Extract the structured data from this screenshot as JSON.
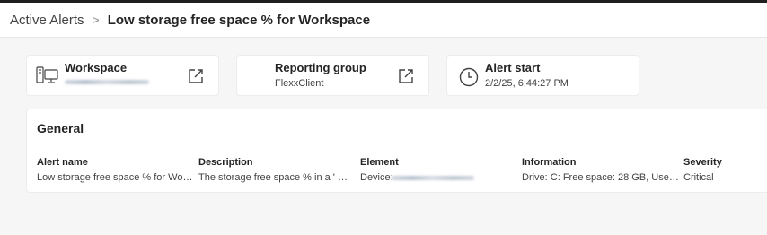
{
  "breadcrumb": {
    "parent": "Active Alerts",
    "separator": ">",
    "current": "Low storage free space % for Workspace"
  },
  "cards": {
    "workspace": {
      "title": "Workspace",
      "value": ""
    },
    "reporting_group": {
      "title": "Reporting group",
      "value": "FlexxClient"
    },
    "alert_start": {
      "title": "Alert start",
      "value": "2/2/25, 6:44:27 PM"
    }
  },
  "general": {
    "title": "General",
    "columns": [
      {
        "header": "Alert name",
        "value": "Low storage free space % for Work..."
      },
      {
        "header": "Description",
        "value": "The storage free space % in a ' Wor..."
      },
      {
        "header": "Element",
        "value": "Device: "
      },
      {
        "header": "Information",
        "value": "Drive: C: Free space: 28 GB, Used Pe..."
      },
      {
        "header": "Severity",
        "value": "Critical"
      }
    ]
  },
  "icons": {
    "workspace": "desktop-computer-icon",
    "open": "open-external-icon",
    "clock": "clock-icon"
  },
  "colors": {
    "topbar": "#1f1f1f",
    "text": "#242424",
    "muted": "#424242"
  }
}
